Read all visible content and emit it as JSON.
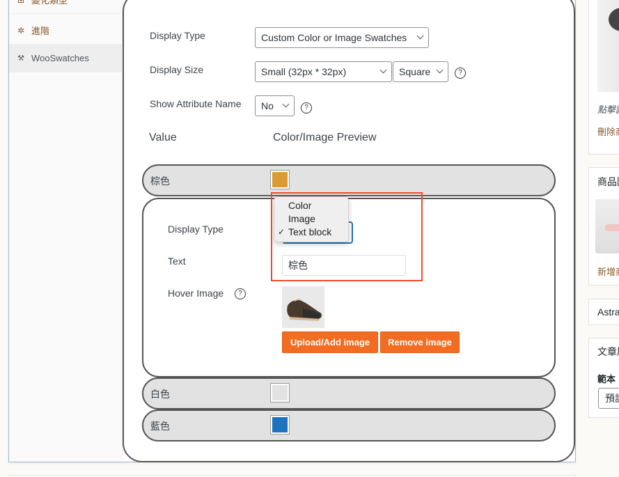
{
  "sidebar": {
    "items": [
      {
        "label": "變化類型",
        "icon": "grid-icon",
        "glyph": "⊞"
      },
      {
        "label": "進階",
        "icon": "gear-icon",
        "glyph": "✲"
      },
      {
        "label": "WooSwatches",
        "icon": "wrench-icon",
        "glyph": "🔧"
      }
    ],
    "active": "WooSwatches"
  },
  "settings": {
    "display_type": {
      "label": "Display Type",
      "value": "Custom Color or Image Swatches"
    },
    "display_size": {
      "label": "Display Size",
      "value": "Small (32px * 32px)",
      "shape_value": "Square"
    },
    "show_attribute_name": {
      "label": "Show Attribute Name",
      "value": "No"
    },
    "help_glyph": "?"
  },
  "columns": {
    "value": "Value",
    "preview": "Color/Image Preview"
  },
  "attributes": [
    {
      "name": "棕色",
      "color": "#dd9933",
      "expanded": true
    },
    {
      "name": "白色",
      "color": "#e2e2e2",
      "expanded": false
    },
    {
      "name": "藍色",
      "color": "#1e73be",
      "expanded": false
    }
  ],
  "detail": {
    "display_type_label": "Display Type",
    "display_type_options": [
      "Color",
      "Image",
      "Text block"
    ],
    "display_type_selected": "Text block",
    "check_glyph": "✓",
    "text_label": "Text",
    "text_value": "棕色",
    "hover_image_label": "Hover Image",
    "upload_button": "Upload/Add image",
    "remove_button": "Remove image"
  },
  "right_sidebar": {
    "image_caption": "點擊圖",
    "remove_link": "刪除商",
    "gallery_title": "商品圖",
    "add_link": "新增商",
    "astra_title": "Astra",
    "post_attr_title": "文章屬",
    "template_label": "範本",
    "template_value": "預設"
  }
}
